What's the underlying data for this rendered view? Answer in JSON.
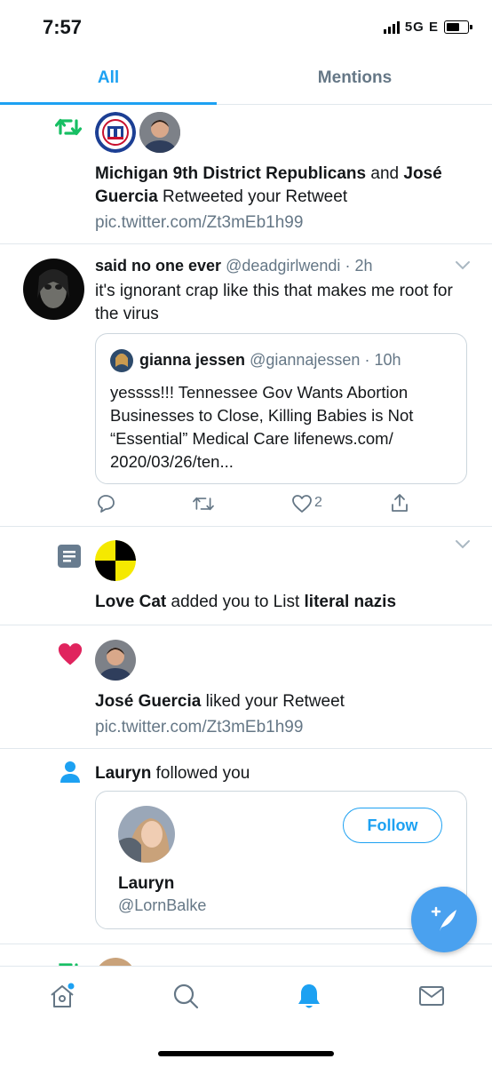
{
  "status_bar": {
    "time": "7:57",
    "network": "5G E"
  },
  "tabs": [
    {
      "label": "All",
      "active": true
    },
    {
      "label": "Mentions",
      "active": false
    }
  ],
  "retweet_notif": {
    "icon": "retweet-icon",
    "actor1": "Michigan 9th District Republicans",
    "and": " and ",
    "actor2": "José Guercia",
    "action": " Retweeted your Retweet",
    "link": "pic.twitter.com/Zt3mEb1h99"
  },
  "tweet": {
    "name": "said no one ever",
    "handle": "@deadgirlwendi",
    "time": "· 2h",
    "text": "it's ignorant crap like this that makes me root for the virus",
    "quote": {
      "name": "gianna jessen",
      "handle": "@giannajessen",
      "time": "· 10h",
      "text": "yessss!!! Tennessee Gov Wants Abortion Businesses to Close, Killing Babies is Not “Essential” Medical Care lifenews.com/ 2020/03/26/ten..."
    },
    "like_count": "2"
  },
  "list_notif": {
    "icon": "list-icon",
    "actor": "Love Cat",
    "action": " added you to List ",
    "list_name": "literal nazis"
  },
  "like_notif": {
    "icon": "heart-icon",
    "actor": "José Guercia",
    "action": " liked your Retweet",
    "link": "pic.twitter.com/Zt3mEb1h99"
  },
  "follow_notif": {
    "icon": "person-icon",
    "actor": "Lauryn",
    "action": " followed you",
    "card": {
      "name": "Lauryn",
      "handle": "@LornBalke",
      "follow_label": "Follow"
    }
  },
  "bottom_nav": [
    "home-icon",
    "search-icon",
    "notifications-icon",
    "messages-icon"
  ],
  "colors": {
    "accent": "#1da1f2",
    "retweet": "#17bf63",
    "like": "#e0245e",
    "muted": "#657786"
  }
}
